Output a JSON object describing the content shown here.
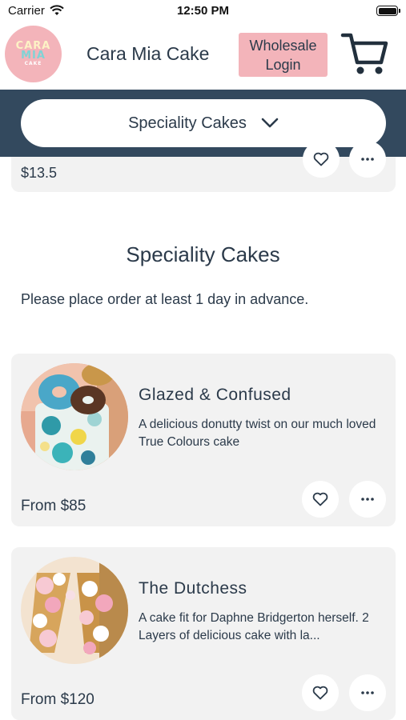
{
  "status_bar": {
    "carrier": "Carrier",
    "time": "12:50 PM"
  },
  "header": {
    "logo_lines": [
      "CARA",
      "MIA",
      "CAKE"
    ],
    "title": "Cara Mia Cake",
    "wholesale_line1": "Wholesale",
    "wholesale_line2": "Login",
    "cart_icon": "cart-icon"
  },
  "category": {
    "selected": "Speciality Cakes",
    "icon": "chevron-down-icon"
  },
  "partial_card": {
    "price": "$13.5"
  },
  "section": {
    "title": "Speciality Cakes",
    "subtitle": "Please place order at least 1 day in advance."
  },
  "products": [
    {
      "name": "Glazed & Confused",
      "description": "A delicious donutty twist on our much loved True Colours cake",
      "price": "From $85"
    },
    {
      "name": "The Dutchess",
      "description": "A cake fit for Daphne Bridgerton herself. 2 Layers of delicious cake with la...",
      "price": "From $120"
    }
  ],
  "colors": {
    "brand_pink": "#f3b4ba",
    "navy": "#33495e",
    "text": "#2b3a4a",
    "card_bg": "#f2f2f2"
  }
}
